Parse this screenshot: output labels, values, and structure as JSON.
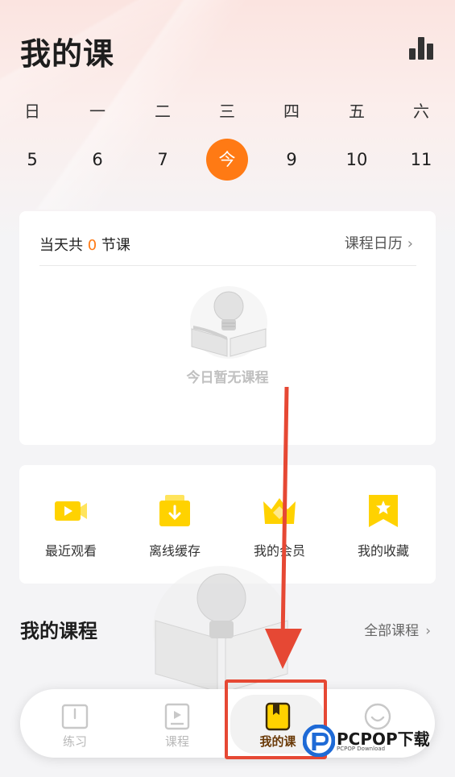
{
  "header": {
    "title": "我的课",
    "stats_icon": "bar-chart-icon"
  },
  "calendar": {
    "weekdays": [
      "日",
      "一",
      "二",
      "三",
      "四",
      "五",
      "六"
    ],
    "dates": [
      "5",
      "6",
      "7",
      "今",
      "9",
      "10",
      "11"
    ],
    "today_index": 3
  },
  "schedule": {
    "prefix": "当天共",
    "count": "0",
    "suffix": "节课",
    "calendar_link": "课程日历",
    "empty_text": "今日暂无课程"
  },
  "quick_links": [
    {
      "label": "最近观看",
      "icon": "video-icon"
    },
    {
      "label": "离线缓存",
      "icon": "download-folder-icon"
    },
    {
      "label": "我的会员",
      "icon": "crown-icon"
    },
    {
      "label": "我的收藏",
      "icon": "bookmark-star-icon"
    }
  ],
  "my_courses": {
    "title": "我的课程",
    "all_link": "全部课程"
  },
  "tabbar": {
    "tabs": [
      {
        "label": "练习",
        "icon": "practice-book-icon"
      },
      {
        "label": "课程",
        "icon": "course-play-icon"
      },
      {
        "label": "我的课",
        "icon": "my-course-icon"
      },
      {
        "label": "",
        "icon": "profile-smile-icon"
      }
    ],
    "active_index": 2
  },
  "watermark": {
    "brand": "PCPOP下载",
    "sub": "PCPOP Download"
  },
  "colors": {
    "accent": "#ff7a14",
    "highlight_red": "#e64834",
    "active_tab_text": "#6a3a08",
    "icon_yellow": "#ffd200"
  }
}
